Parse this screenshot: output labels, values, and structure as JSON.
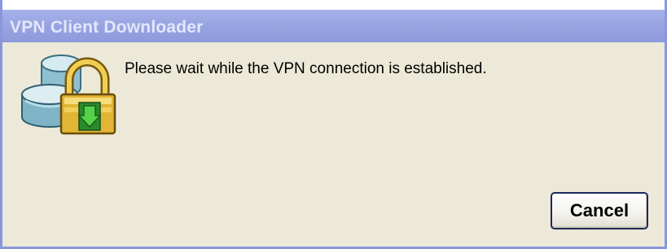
{
  "window": {
    "title": "VPN Client Downloader"
  },
  "dialog": {
    "message": "Please wait while the VPN connection is established.",
    "icon": "vpn-lock-download-icon"
  },
  "buttons": {
    "cancel_label": "Cancel"
  },
  "colors": {
    "titlebar": "#9aa6e2",
    "dialog_background": "#ece9d8"
  }
}
